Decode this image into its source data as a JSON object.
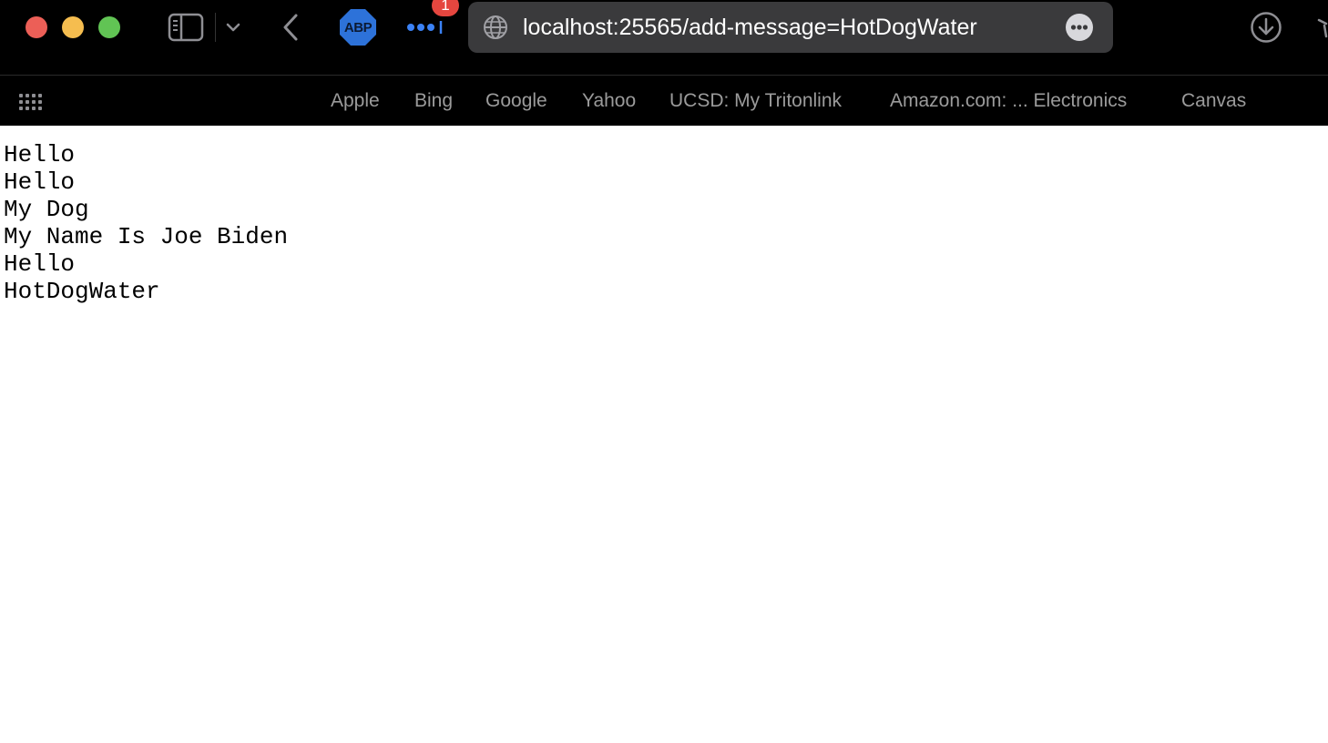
{
  "window": {
    "traffic_lights": [
      {
        "name": "close",
        "color": "#ec5f57"
      },
      {
        "name": "minimize",
        "color": "#f5bd4f"
      },
      {
        "name": "zoom",
        "color": "#61c454"
      }
    ]
  },
  "toolbar": {
    "sidebar_icon": "sidebar-icon",
    "dropdown_icon": "chevron-down-icon",
    "back_icon": "chevron-left-icon",
    "abp_label": "ABP",
    "extension_badge": "1",
    "extension_icon": "dots-icon",
    "download_icon": "download-icon"
  },
  "address_bar": {
    "url": "localhost:25565/add-message=HotDogWater",
    "globe_icon": "globe-icon",
    "more_icon": "ellipsis-circle-icon"
  },
  "bookmarks": {
    "grid_icon": "grid-icon",
    "items": [
      {
        "label": "Apple"
      },
      {
        "label": "Bing"
      },
      {
        "label": "Google"
      },
      {
        "label": "Yahoo"
      },
      {
        "label": "UCSD: My Tritonlink"
      },
      {
        "label": "Amazon.com: ... Electronics"
      },
      {
        "label": "Canvas"
      }
    ]
  },
  "page": {
    "lines": [
      "Hello",
      "Hello",
      "My Dog",
      "My Name Is Joe Biden",
      "Hello",
      "HotDogWater"
    ]
  },
  "colors": {
    "chrome_background": "#000000",
    "address_bar_background": "#3a3a3c",
    "bookmark_text": "#9b9b9b",
    "page_background": "#ffffff",
    "abp_blue": "#2d72d9",
    "badge_red": "#e5463f"
  }
}
